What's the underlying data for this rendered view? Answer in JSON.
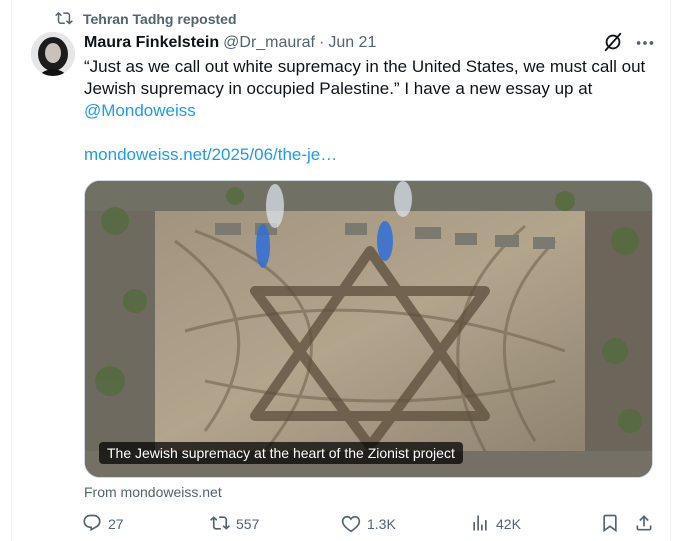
{
  "repost": {
    "label": "Tehran Tadhg reposted",
    "icon": "repost-icon"
  },
  "tweet": {
    "author_name": "Maura Finkelstein",
    "handle": "@Dr_mauraf",
    "separator": "·",
    "date": "Jun 21",
    "text_lines": [
      "“Just as we call out white supremacy in the United States, we must call out",
      "Jewish supremacy in occupied Palestine.” I have a new essay up at"
    ],
    "mention": "@Mondoweiss",
    "link": "mondoweiss.net/2025/06/the-je…",
    "media_caption": "The Jewish supremacy at the heart of the Zionist project",
    "source": "From mondoweiss.net"
  },
  "actions": {
    "replies": "27",
    "reposts": "557",
    "likes": "1.3K",
    "views": "42K"
  },
  "colors": {
    "accent": "#1d9bf0",
    "muted_text": "#536471",
    "primary_text": "#0f1419"
  }
}
